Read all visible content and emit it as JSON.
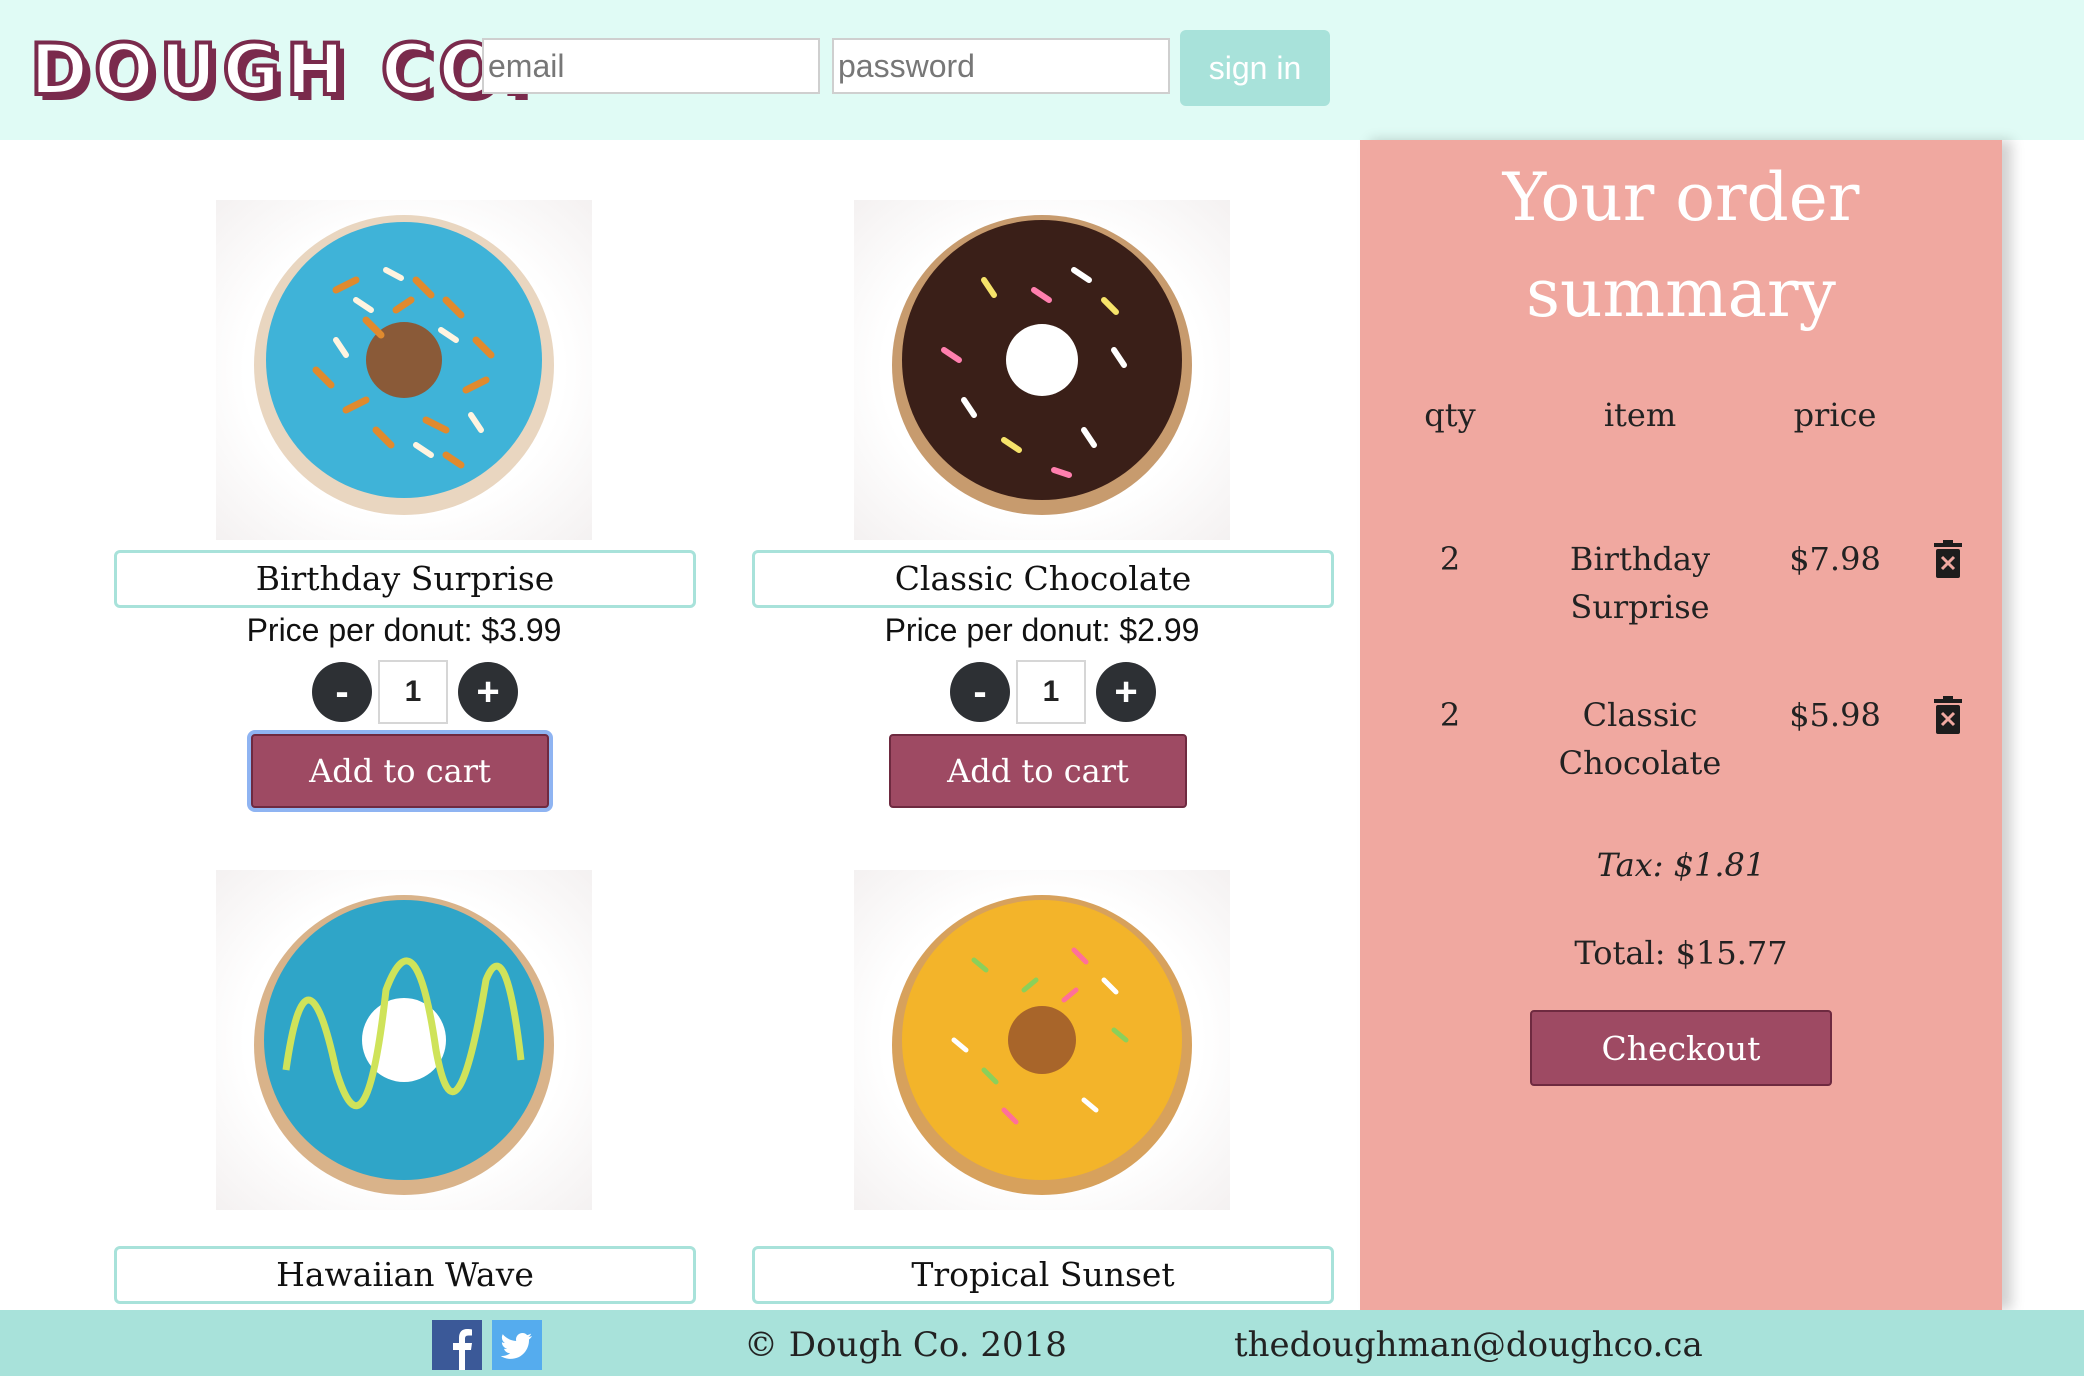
{
  "header": {
    "logo": "DOUGH CO.",
    "email_placeholder": "email",
    "password_placeholder": "password",
    "signin_label": "sign in"
  },
  "products": [
    {
      "name": "Birthday Surprise",
      "price_text": "Price per donut: $3.99",
      "qty": "1",
      "add_label": "Add to cart",
      "icon": "blue-coconut-donut"
    },
    {
      "name": "Classic Chocolate",
      "price_text": "Price per donut: $2.99",
      "qty": "1",
      "add_label": "Add to cart",
      "icon": "chocolate-sprinkle-donut"
    },
    {
      "name": "Hawaiian Wave",
      "icon": "blue-drizzle-donut"
    },
    {
      "name": "Tropical Sunset",
      "icon": "yellow-sprinkle-donut"
    }
  ],
  "stepper": {
    "minus": "-",
    "plus": "+"
  },
  "order": {
    "title_line1": "Your order",
    "title_line2": "summary",
    "headers": {
      "qty": "qty",
      "item": "item",
      "price": "price"
    },
    "rows": [
      {
        "qty": "2",
        "item_line1": "Birthday",
        "item_line2": "Surprise",
        "price": "$7.98"
      },
      {
        "qty": "2",
        "item_line1": "Classic",
        "item_line2": "Chocolate",
        "price": "$5.98"
      }
    ],
    "tax": "Tax: $1.81",
    "total": "Total: $15.77",
    "checkout_label": "Checkout"
  },
  "footer": {
    "copyright": "© Dough Co. 2018",
    "email": "thedoughman@doughco.ca",
    "social": [
      "facebook-icon",
      "twitter-icon"
    ]
  },
  "colors": {
    "header_bg": "#e0fbf5",
    "accent": "#a8e2da",
    "button": "#9e4a63",
    "order_bg": "#f0a8a0",
    "logo": "#7a2a4c"
  }
}
